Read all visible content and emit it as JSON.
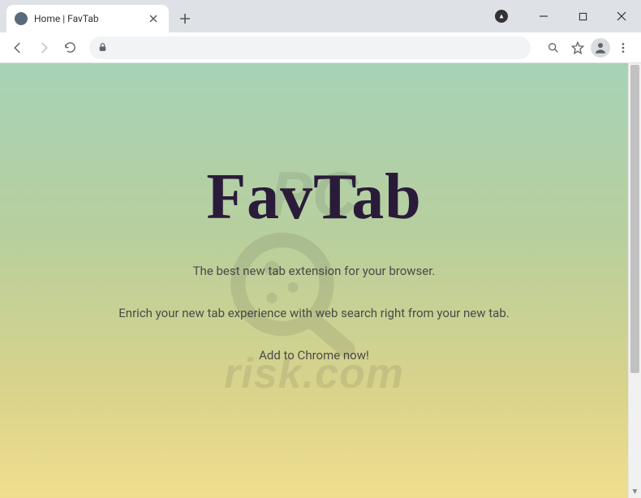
{
  "window": {
    "tab_title": "Home | FavTab"
  },
  "page": {
    "logo_text": "FavTab",
    "tagline": "The best new tab extension for your browser.",
    "subline": "Enrich your new tab experience with web search right from your new tab.",
    "cta": "Add to Chrome now!"
  },
  "watermark": {
    "text": "risk.com"
  }
}
